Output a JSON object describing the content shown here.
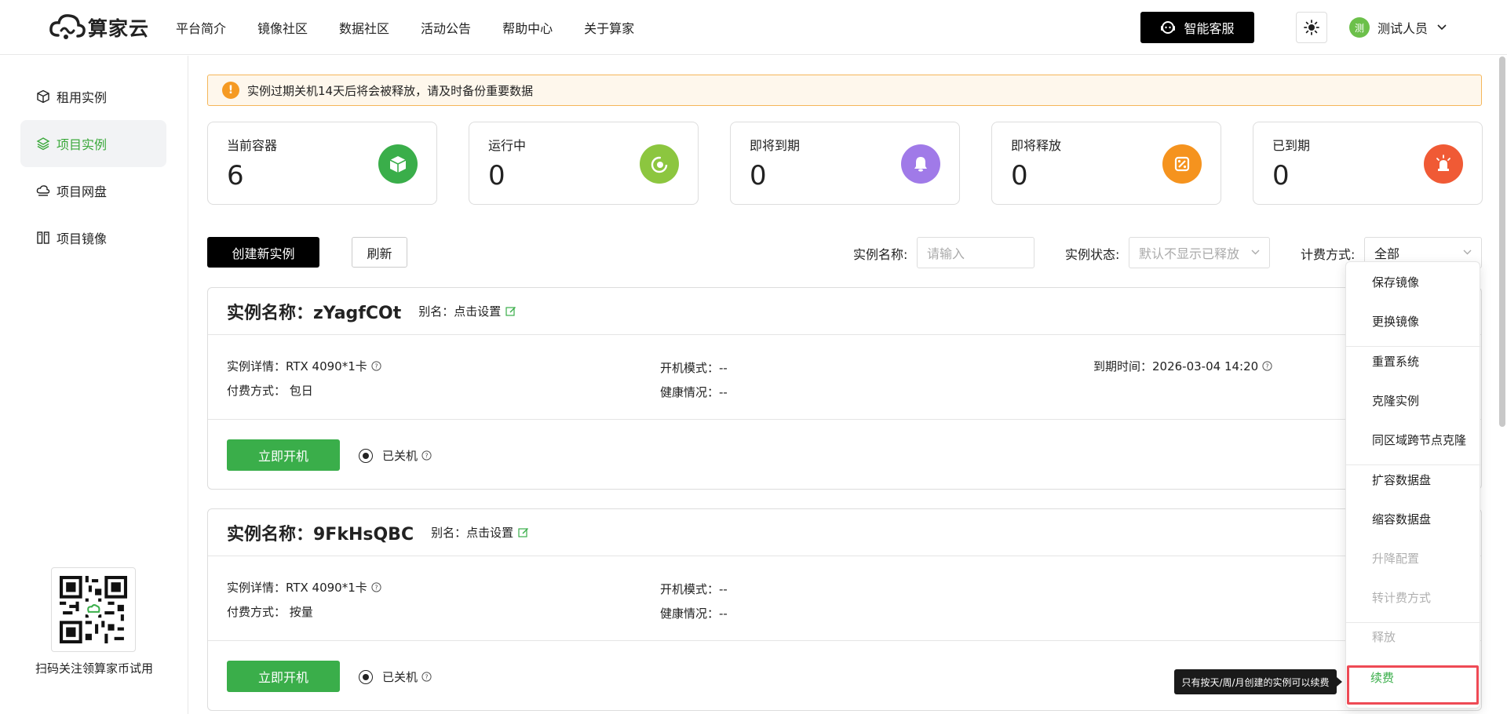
{
  "header": {
    "logo_text": "算家云",
    "nav": [
      "平台简介",
      "镜像社区",
      "数据社区",
      "活动公告",
      "帮助中心",
      "关于算家"
    ],
    "service_label": "智能客服",
    "user_initial": "测",
    "user_name": "测试人员"
  },
  "sidebar": {
    "items": [
      {
        "label": "租用实例",
        "icon": "cube-icon"
      },
      {
        "label": "项目实例",
        "icon": "layers-icon",
        "active": true
      },
      {
        "label": "项目网盘",
        "icon": "cloud-disk-icon"
      },
      {
        "label": "项目镜像",
        "icon": "mirror-icon"
      }
    ],
    "qr_caption": "扫码关注领算家币试用"
  },
  "alert": {
    "text": "实例过期关机14天后将会被释放，请及时备份重要数据"
  },
  "stats": [
    {
      "label": "当前容器",
      "value": "6",
      "color": "#3aae4a"
    },
    {
      "label": "运行中",
      "value": "0",
      "color": "#8cc63f"
    },
    {
      "label": "即将到期",
      "value": "0",
      "color": "#a07ae8"
    },
    {
      "label": "即将释放",
      "value": "0",
      "color": "#f5931e"
    },
    {
      "label": "已到期",
      "value": "0",
      "color": "#f05a35"
    }
  ],
  "toolbar": {
    "create_label": "创建新实例",
    "refresh_label": "刷新",
    "name_label": "实例名称:",
    "name_placeholder": "请输入",
    "status_label": "实例状态:",
    "status_placeholder": "默认不显示已释放",
    "billing_label": "计费方式:",
    "billing_value": "全部"
  },
  "instances": [
    {
      "title": "实例名称：zYagfCOt",
      "alias_label": "别名：点击设置",
      "detail": "实例详情：RTX 4090*1卡",
      "payment": "付费方式：  包日",
      "boot_mode": "开机模式：--",
      "health": "健康情况：--",
      "expire": "到期时间：2026-03-04 14:20",
      "start_label": "立即开机",
      "status": "已关机"
    },
    {
      "title": "实例名称：9FkHsQBC",
      "alias_label": "别名：点击设置",
      "detail": "实例详情：RTX 4090*1卡",
      "payment": "付费方式：  按量",
      "boot_mode": "开机模式：--",
      "health": "健康情况：--",
      "start_label": "立即开机",
      "status": "已关机"
    }
  ],
  "dropdown": {
    "items": [
      {
        "label": "保存镜像",
        "disabled": false
      },
      {
        "label": "更换镜像",
        "disabled": false
      },
      {
        "label": "重置系统",
        "disabled": false
      },
      {
        "label": "克隆实例",
        "disabled": false
      },
      {
        "label": "同区域跨节点克隆",
        "disabled": false
      },
      {
        "label": "扩容数据盘",
        "disabled": false
      },
      {
        "label": "缩容数据盘",
        "disabled": false
      },
      {
        "label": "升降配置",
        "disabled": true
      },
      {
        "label": "转计费方式",
        "disabled": true
      },
      {
        "label": "释放",
        "disabled": true
      },
      {
        "label": "续费",
        "disabled": false,
        "highlighted": true
      }
    ],
    "tooltip": "只有按天/周/月创建的实例可以续费"
  }
}
